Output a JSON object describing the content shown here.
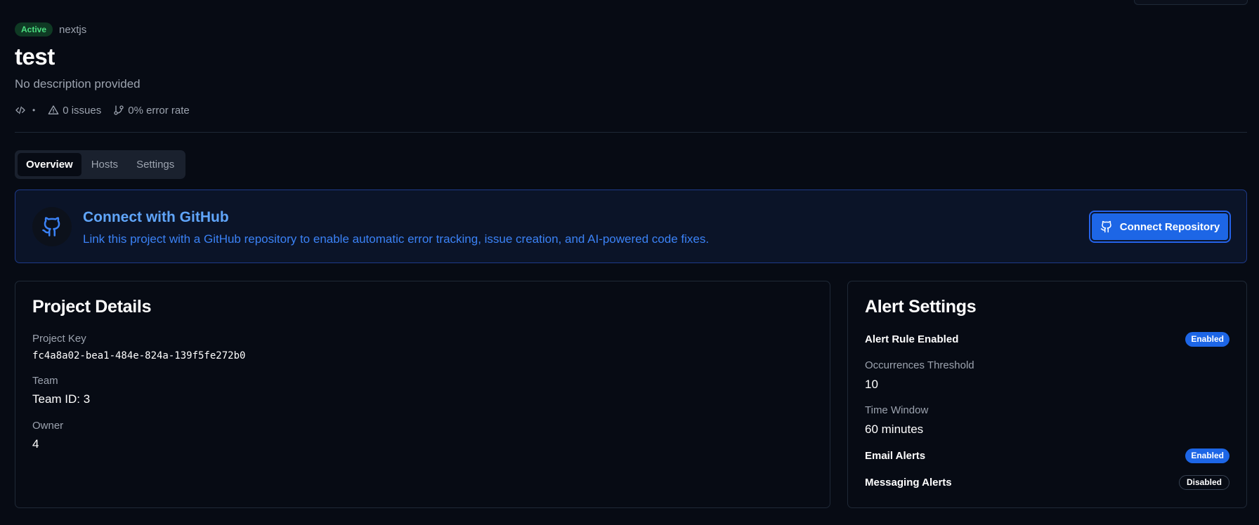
{
  "header": {
    "status": "Active",
    "framework": "nextjs",
    "title": "test",
    "description": "No description provided",
    "meta": {
      "separator": "•",
      "issues": "0 issues",
      "error_rate": "0% error rate"
    }
  },
  "tabs": [
    {
      "label": "Overview",
      "active": true
    },
    {
      "label": "Hosts",
      "active": false
    },
    {
      "label": "Settings",
      "active": false
    }
  ],
  "github": {
    "title": "Connect with GitHub",
    "text": "Link this project with a GitHub repository to enable automatic error tracking, issue creation, and AI-powered code fixes.",
    "button_label": "Connect Repository"
  },
  "project_details": {
    "title": "Project Details",
    "key_label": "Project Key",
    "key_value": "fc4a8a02-bea1-484e-824a-139f5fe272b0",
    "team_label": "Team",
    "team_value": "Team ID: 3",
    "owner_label": "Owner",
    "owner_value": "4"
  },
  "alert_settings": {
    "title": "Alert Settings",
    "alert_rule_label": "Alert Rule Enabled",
    "alert_rule_status": "Enabled",
    "threshold_label": "Occurrences Threshold",
    "threshold_value": "10",
    "window_label": "Time Window",
    "window_value": "60 minutes",
    "email_label": "Email Alerts",
    "email_status": "Enabled",
    "messaging_label": "Messaging Alerts",
    "messaging_status": "Disabled"
  },
  "colors": {
    "background": "#070b14",
    "accent": "#1d66e6",
    "link_blue": "#3b82f6",
    "active_green": "#4ade80"
  },
  "icons": [
    "code-icon",
    "alert-triangle-icon",
    "git-branch-icon",
    "github-icon"
  ]
}
